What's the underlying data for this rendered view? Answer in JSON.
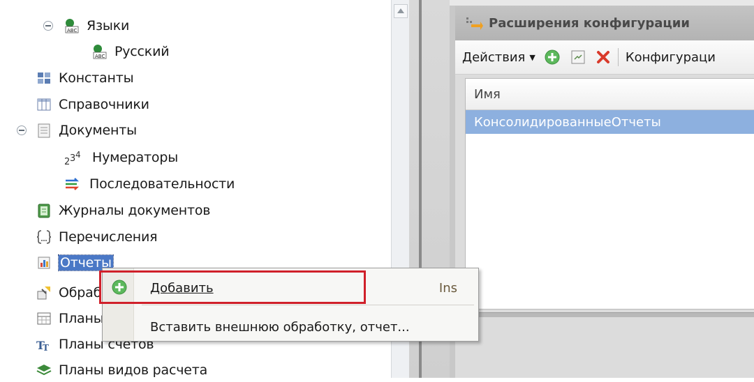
{
  "tree": {
    "items": [
      {
        "label": "Языки",
        "icon": "languages-icon"
      },
      {
        "label": "Русский",
        "icon": "language-item-icon"
      },
      {
        "label": "Константы",
        "icon": "constants-icon"
      },
      {
        "label": "Справочники",
        "icon": "catalogs-icon"
      },
      {
        "label": "Документы",
        "icon": "documents-icon"
      },
      {
        "label": "Нумераторы",
        "icon": "numerators-icon"
      },
      {
        "label": "Последовательности",
        "icon": "sequences-icon"
      },
      {
        "label": "Журналы документов",
        "icon": "document-journals-icon"
      },
      {
        "label": "Перечисления",
        "icon": "enumerations-icon"
      },
      {
        "label": "Отчеты",
        "icon": "reports-icon"
      },
      {
        "label": "Обработки",
        "icon": "data-processors-icon"
      },
      {
        "label": "Планы видов характеристик",
        "icon": "characteristic-types-icon"
      },
      {
        "label": "Планы счетов",
        "icon": "chart-of-accounts-icon"
      },
      {
        "label": "Планы видов расчета",
        "icon": "calculation-types-icon"
      }
    ]
  },
  "window": {
    "title": "Расширения конфигурации",
    "toolbar": {
      "actions_label": "Действия",
      "config_label": "Конфигураци"
    },
    "grid": {
      "column_header": "Имя",
      "rows": [
        "КонсолидированныеОтчеты"
      ]
    }
  },
  "context_menu": {
    "items": [
      {
        "label": "Добавить",
        "shortcut": "Ins"
      },
      {
        "label": "Вставить внешнюю обработку, отчет...",
        "shortcut": ""
      }
    ]
  },
  "colors": {
    "selection": "#4a78c6",
    "grid_selection": "#8db0df",
    "highlight_border": "#d0202a"
  }
}
